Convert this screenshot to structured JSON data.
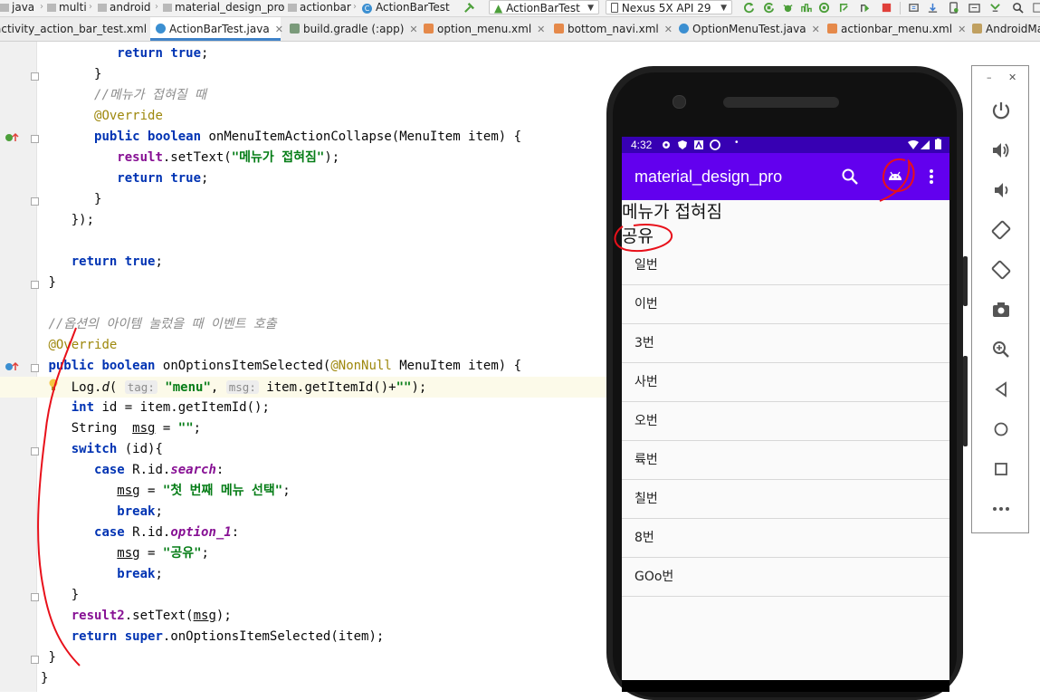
{
  "breadcrumb": [
    "java",
    "multi",
    "android",
    "material_design_pro",
    "actionbar",
    "ActionBarTest"
  ],
  "toolbar": {
    "run_config": "ActionBarTest",
    "device": "Nexus 5X API 29"
  },
  "tabs": [
    {
      "label": "activity_action_bar_test.xml",
      "active": false
    },
    {
      "label": "ActionBarTest.java",
      "active": true
    },
    {
      "label": "build.gradle (:app)",
      "active": false
    },
    {
      "label": "option_menu.xml",
      "active": false
    },
    {
      "label": "bottom_navi.xml",
      "active": false
    },
    {
      "label": "OptionMenuTest.java",
      "active": false
    },
    {
      "label": "actionbar_menu.xml",
      "active": false
    },
    {
      "label": "AndroidMa",
      "active": false
    }
  ],
  "code": {
    "l1_return": "return",
    "l1_true": "true",
    "l2": "}",
    "l3_comment": "//메뉴가 접혀질 때",
    "l4_annotation": "@Override",
    "l5_public": "public",
    "l5_boolean": "boolean",
    "l5_rest": "onMenuItemActionCollapse(MenuItem item) {",
    "l6_result": "result",
    "l6_settext": ".setText(",
    "l6_str": "\"메뉴가 접혀짐\"",
    "l6_end": ");",
    "l7_return": "return",
    "l7_true": "true",
    "l8": "}",
    "l9": "});",
    "l10_return": "return",
    "l10_true": "true",
    "l11": "}",
    "l12_comment": "//옵션의 아이템 눌렀을 때 이벤트 호출",
    "l13_annotation": "@Override",
    "l14_public": "public",
    "l14_boolean": "boolean",
    "l14_mid": "onOptionsItemSelected(",
    "l14_nonnull": "@NonNull",
    "l14_end": "MenuItem item) {",
    "l15_log": "Log.",
    "l15_d": "d",
    "l15_paren": "(",
    "l15_hint_tag": "tag:",
    "l15_str1": "\"menu\"",
    "l15_comma": ",",
    "l15_hint_msg": "msg:",
    "l15_rest": "item.getItemId()+",
    "l15_str2": "\"\"",
    "l15_end": ");",
    "l16_int": "int",
    "l16_rest": "id = item.getItemId();",
    "l17_string": "String",
    "l17_msg": "msg",
    "l17_eq": "=",
    "l17_str": "\"\"",
    "l18_switch": "switch",
    "l18_rest": "(id){",
    "l19_case": "case",
    "l19_rid": "R.id.",
    "l19_field": "search",
    "l19_colon": ":",
    "l20_msg": "msg",
    "l20_eq": "=",
    "l20_str": "\"첫 번째 메뉴 선택\"",
    "l20_end": ";",
    "l21_break": "break",
    "l22_case": "case",
    "l22_rid": "R.id.",
    "l22_field": "option_1",
    "l22_colon": ":",
    "l23_msg": "msg",
    "l23_eq": "=",
    "l23_str": "\"공유\"",
    "l23_end": ";",
    "l24_break": "break",
    "l25": "}",
    "l26_result2": "result2",
    "l26_settext": ".setText(",
    "l26_msg": "msg",
    "l26_end": ");",
    "l27_return": "return",
    "l27_super": "super",
    "l27_rest": ".onOptionsItemSelected(item);",
    "l28": "}",
    "l29": "}"
  },
  "emulator": {
    "status_time": "4:32",
    "app_title": "material_design_pro",
    "text_collapsed": "메뉴가 접혀짐",
    "text_share": "공유",
    "list_items": [
      "일번",
      "이번",
      "3번",
      "사번",
      "오번",
      "륙번",
      "칠번",
      "8번",
      "GOo번"
    ]
  },
  "colors": {
    "app_bar": "#6200ee",
    "status_bar": "#3700b3",
    "annotation_ink": "#e8101a"
  }
}
